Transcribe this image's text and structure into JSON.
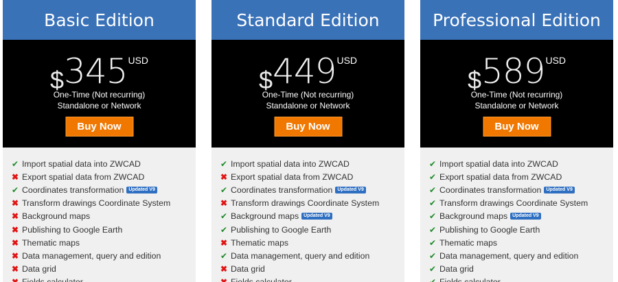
{
  "colors": {
    "header_bg": "#3a72b8",
    "price_bg": "#000000",
    "button_bg": "#f07800",
    "card_bg": "#f0f0f0",
    "check": "#1f8a2a",
    "cross": "#e01414",
    "badge_bg": "#2e6fc2"
  },
  "plans": [
    {
      "title": "Basic Edition",
      "currency": "$",
      "amount": "345",
      "unit": "USD",
      "terms_line1": "One-Time (Not recurring)",
      "terms_line2": "Standalone or Network",
      "button": "Buy Now",
      "features": [
        {
          "label": "Import spatial data into ZWCAD",
          "included": true,
          "icon": "check-icon",
          "badge": ""
        },
        {
          "label": "Export spatial data from ZWCAD",
          "included": false,
          "icon": "cross-icon",
          "badge": ""
        },
        {
          "label": "Coordinates transformation",
          "included": true,
          "icon": "check-icon",
          "badge": "Updated V9"
        },
        {
          "label": "Transform drawings Coordinate System",
          "included": false,
          "icon": "cross-icon",
          "badge": ""
        },
        {
          "label": "Background maps",
          "included": false,
          "icon": "cross-icon",
          "badge": ""
        },
        {
          "label": "Publishing to Google Earth",
          "included": false,
          "icon": "cross-icon",
          "badge": ""
        },
        {
          "label": "Thematic maps",
          "included": false,
          "icon": "cross-icon",
          "badge": ""
        },
        {
          "label": "Data management, query and edition",
          "included": false,
          "icon": "cross-icon",
          "badge": ""
        },
        {
          "label": "Data grid",
          "included": false,
          "icon": "cross-icon",
          "badge": ""
        },
        {
          "label": "Fields calculator",
          "included": false,
          "icon": "cross-icon",
          "badge": ""
        }
      ]
    },
    {
      "title": "Standard Edition",
      "currency": "$",
      "amount": "449",
      "unit": "USD",
      "terms_line1": "One-Time (Not recurring)",
      "terms_line2": "Standalone or Network",
      "button": "Buy Now",
      "features": [
        {
          "label": "Import spatial data into ZWCAD",
          "included": true,
          "icon": "check-icon",
          "badge": ""
        },
        {
          "label": "Export spatial data from ZWCAD",
          "included": false,
          "icon": "cross-icon",
          "badge": ""
        },
        {
          "label": "Coordinates transformation",
          "included": true,
          "icon": "check-icon",
          "badge": "Updated V9"
        },
        {
          "label": "Transform drawings Coordinate System",
          "included": false,
          "icon": "cross-icon",
          "badge": ""
        },
        {
          "label": "Background maps",
          "included": true,
          "icon": "check-icon",
          "badge": "Updated V9"
        },
        {
          "label": "Publishing to Google Earth",
          "included": true,
          "icon": "check-icon",
          "badge": ""
        },
        {
          "label": "Thematic maps",
          "included": false,
          "icon": "cross-icon",
          "badge": ""
        },
        {
          "label": "Data management, query and edition",
          "included": true,
          "icon": "check-icon",
          "badge": ""
        },
        {
          "label": "Data grid",
          "included": false,
          "icon": "cross-icon",
          "badge": ""
        },
        {
          "label": "Fields calculator",
          "included": false,
          "icon": "cross-icon",
          "badge": ""
        }
      ]
    },
    {
      "title": "Professional Edition",
      "currency": "$",
      "amount": "589",
      "unit": "USD",
      "terms_line1": "One-Time (Not recurring)",
      "terms_line2": "Standalone or Network",
      "button": "Buy Now",
      "features": [
        {
          "label": "Import spatial data into ZWCAD",
          "included": true,
          "icon": "check-icon",
          "badge": ""
        },
        {
          "label": "Export spatial data from ZWCAD",
          "included": true,
          "icon": "check-icon",
          "badge": ""
        },
        {
          "label": "Coordinates transformation",
          "included": true,
          "icon": "check-icon",
          "badge": "Updated V9"
        },
        {
          "label": "Transform drawings Coordinate System",
          "included": true,
          "icon": "check-icon",
          "badge": ""
        },
        {
          "label": "Background maps",
          "included": true,
          "icon": "check-icon",
          "badge": "Updated V9"
        },
        {
          "label": "Publishing to Google Earth",
          "included": true,
          "icon": "check-icon",
          "badge": ""
        },
        {
          "label": "Thematic maps",
          "included": true,
          "icon": "check-icon",
          "badge": ""
        },
        {
          "label": "Data management, query and edition",
          "included": true,
          "icon": "check-icon",
          "badge": ""
        },
        {
          "label": "Data grid",
          "included": true,
          "icon": "check-icon",
          "badge": ""
        },
        {
          "label": "Fields calculator",
          "included": true,
          "icon": "check-icon",
          "badge": ""
        }
      ]
    }
  ]
}
